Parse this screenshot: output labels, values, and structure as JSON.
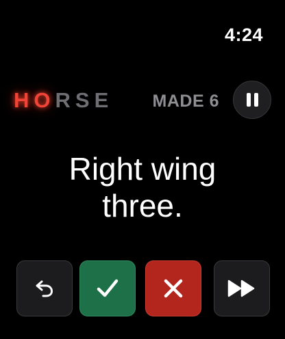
{
  "status_bar": {
    "time": "4:24"
  },
  "score": {
    "letters": [
      {
        "char": "H",
        "active": true
      },
      {
        "char": "O",
        "active": true
      },
      {
        "char": "R",
        "active": false
      },
      {
        "char": "S",
        "active": false
      },
      {
        "char": "E",
        "active": false
      }
    ],
    "made_label": "MADE 6"
  },
  "prompt": {
    "line1": "Right wing",
    "line2": "three."
  },
  "controls": {
    "undo_icon": "undo-arrow-icon",
    "made_icon": "checkmark-icon",
    "missed_icon": "x-mark-icon",
    "skip_icon": "fast-forward-icon"
  },
  "colors": {
    "background": "#000000",
    "active_letter": "#f04438",
    "inactive_letter": "#6e6e73",
    "made_label": "#8e8e93",
    "made_button": "#1d7048",
    "missed_button": "#b3261e",
    "neutral_button": "#1c1c1e"
  }
}
